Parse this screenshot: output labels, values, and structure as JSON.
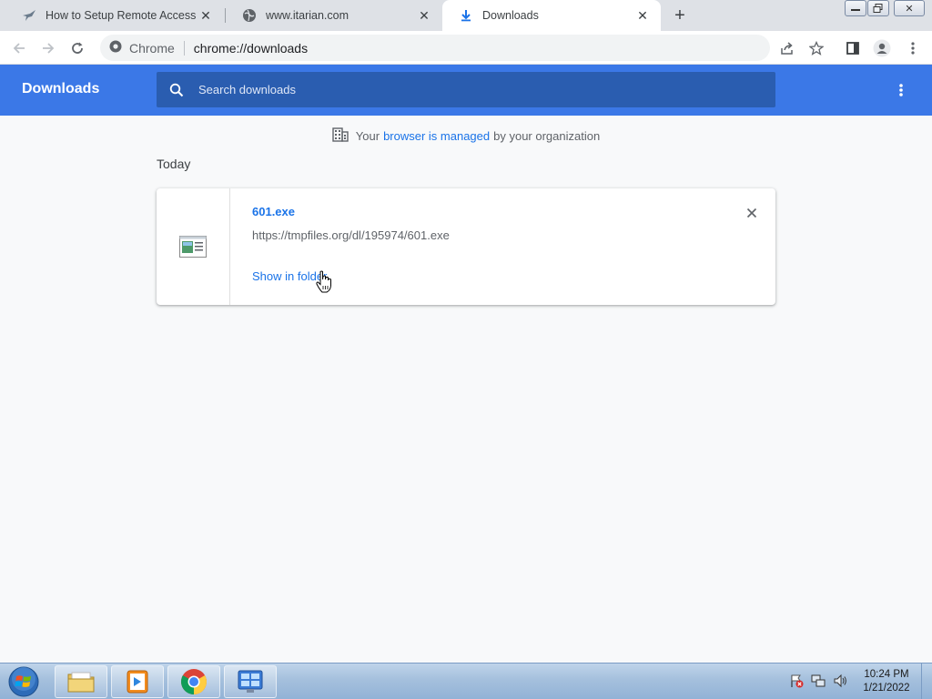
{
  "tabs": [
    {
      "title": "How to Setup Remote Access Wi",
      "favicon": "itarian-bird-icon"
    },
    {
      "title": "www.itarian.com",
      "favicon": "globe-icon"
    },
    {
      "title": "Downloads",
      "favicon": "download-icon",
      "active": true
    }
  ],
  "toolbar": {
    "site_label": "Chrome",
    "url": "chrome://downloads"
  },
  "downloads_header": {
    "title": "Downloads",
    "search_placeholder": "Search downloads"
  },
  "managed_notice": {
    "prefix": "Your",
    "link": "browser is managed",
    "suffix": "by your organization"
  },
  "section": {
    "date": "Today"
  },
  "download": {
    "filename": "601.exe",
    "url": "https://tmpfiles.org/dl/195974/601.exe",
    "action": "Show in folder"
  },
  "taskbar": {
    "time": "10:24 PM",
    "date": "1/21/2022"
  },
  "colors": {
    "header_blue": "#3b78e7",
    "search_blue": "#2a5db0",
    "link_blue": "#1a73e8",
    "page_bg": "#f8f9fa"
  }
}
